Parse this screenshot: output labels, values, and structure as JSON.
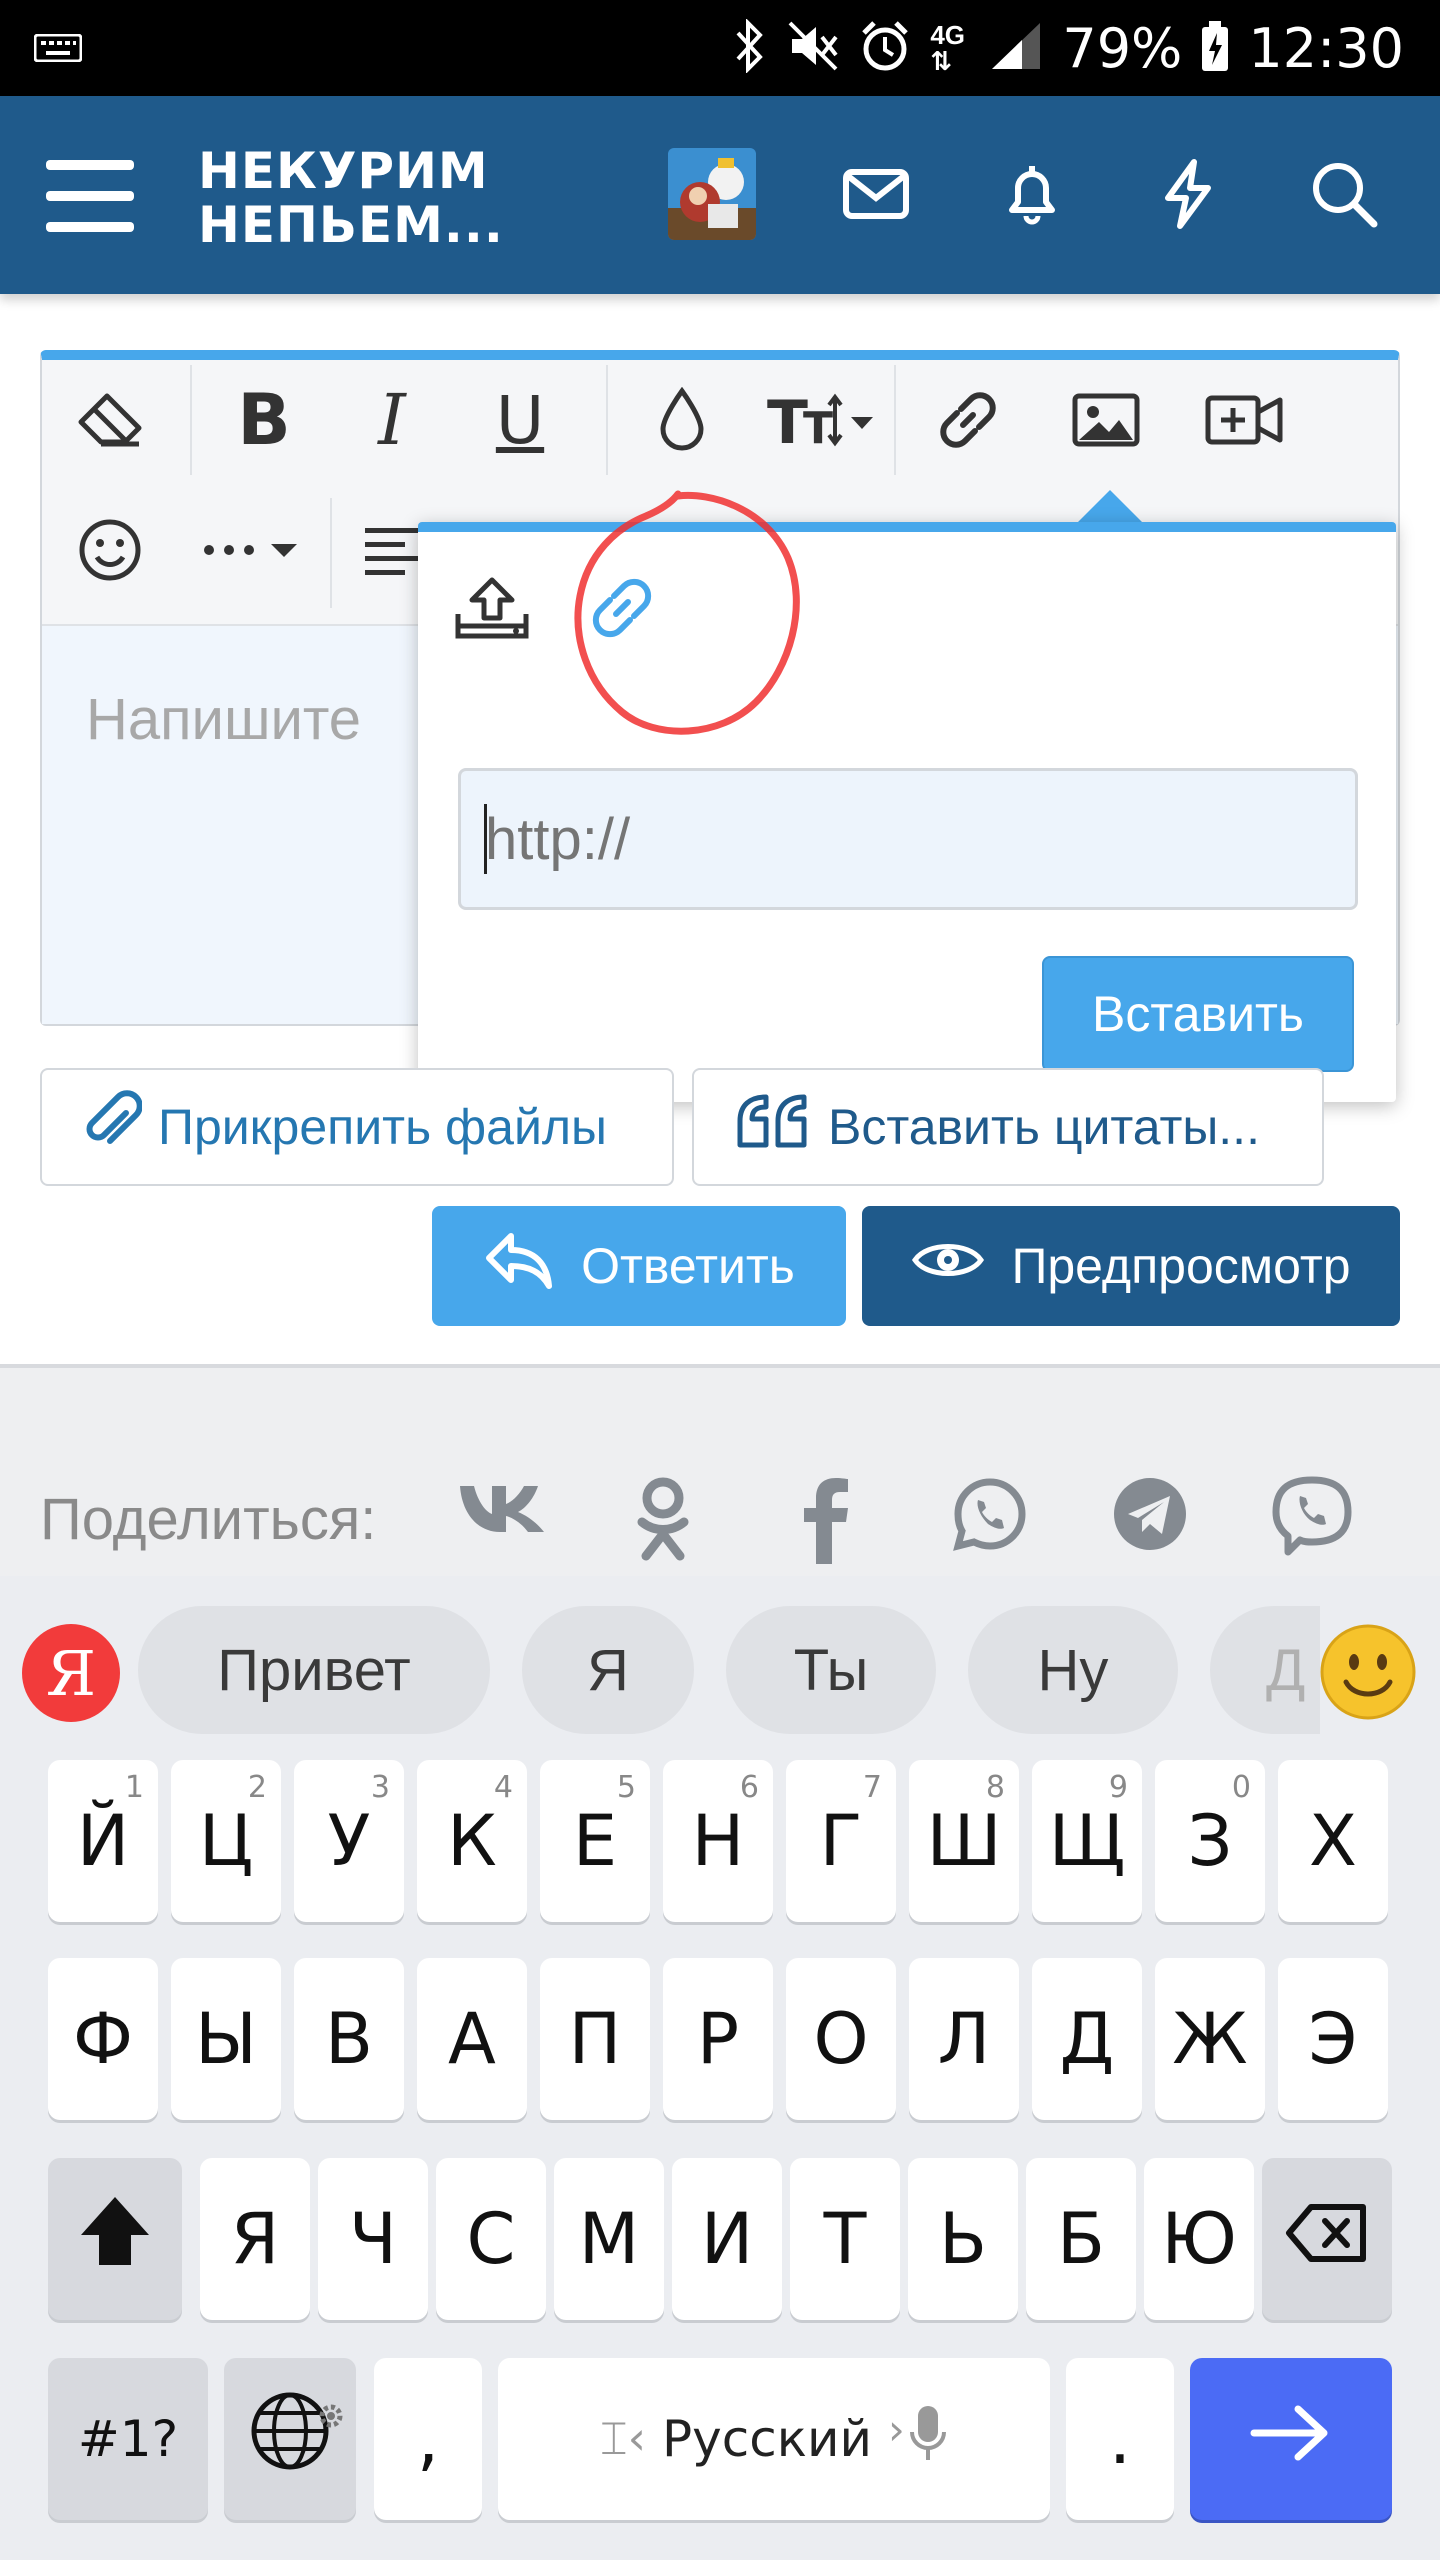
{
  "status_bar": {
    "battery_percent": "79%",
    "time": "12:30",
    "network": "4G"
  },
  "header": {
    "brand_line1": "НЕКУРИМ",
    "brand_line2": "НЕПЬЕМ...",
    "icons": [
      "menu-icon",
      "avatar",
      "mail-icon",
      "bell-icon",
      "lightning-icon",
      "search-icon"
    ]
  },
  "editor": {
    "toolbar_row1": [
      "eraser-icon",
      "bold-icon",
      "italic-icon",
      "underline-icon",
      "color-drop-icon",
      "text-size-icon",
      "link-icon",
      "image-icon",
      "video-icon"
    ],
    "toolbar_row2": [
      "smiley-icon",
      "more-icon",
      "align-icon"
    ],
    "placeholder": "Напишите "
  },
  "link_popup": {
    "url_placeholder": "http://",
    "insert_label": "Вставить",
    "tabs": [
      "upload-icon",
      "link-icon"
    ]
  },
  "actions": {
    "attach_label": "Прикрепить файлы",
    "insert_quotes_label": "Вставить цитаты...",
    "reply_label": "Ответить",
    "preview_label": "Предпросмотр"
  },
  "share": {
    "label": "Поделиться:",
    "networks": [
      "vk-icon",
      "odnoklassniki-icon",
      "facebook-icon",
      "whatsapp-icon",
      "telegram-icon",
      "viber-icon"
    ]
  },
  "keyboard": {
    "yandex_logo": "Я",
    "suggestions": [
      "Привет",
      "Я",
      "Ты",
      "Ну",
      "Д"
    ],
    "row1": [
      "Й",
      "Ц",
      "У",
      "К",
      "Е",
      "Н",
      "Г",
      "Ш",
      "Щ",
      "З",
      "Х"
    ],
    "row1_hints": [
      "1",
      "2",
      "3",
      "4",
      "5",
      "6",
      "7",
      "8",
      "9",
      "0",
      ""
    ],
    "row2": [
      "Ф",
      "Ы",
      "В",
      "А",
      "П",
      "Р",
      "О",
      "Л",
      "Д",
      "Ж",
      "Э"
    ],
    "row3": [
      "Я",
      "Ч",
      "С",
      "М",
      "И",
      "Т",
      "Ь",
      "Б",
      "Ю"
    ],
    "symbols_label": "#1?",
    "comma": ",",
    "space_label": "Русский",
    "period": ".",
    "accent_color": "#4b6bf5"
  }
}
